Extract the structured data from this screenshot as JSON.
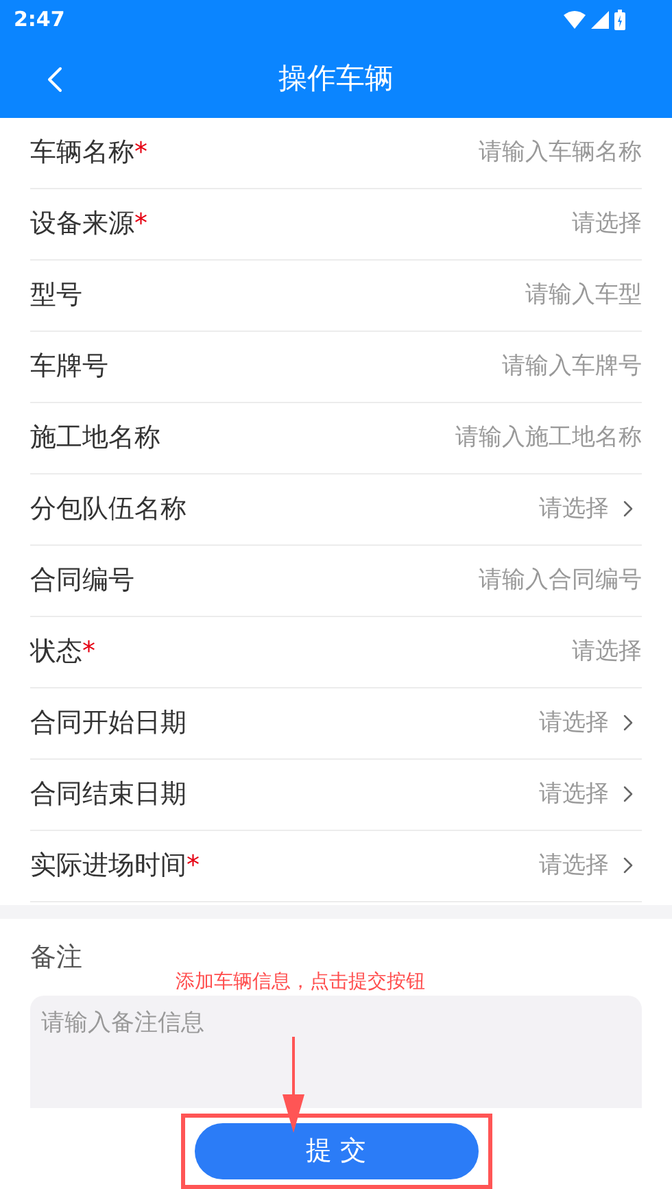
{
  "status_bar": {
    "time": "2:47"
  },
  "header": {
    "title": "操作车辆"
  },
  "fields": [
    {
      "label": "车辆名称",
      "required_mark": "*",
      "placeholder": "请输入车辆名称",
      "chevron": false
    },
    {
      "label": "设备来源",
      "required_mark": "*",
      "placeholder": "请选择",
      "chevron": false
    },
    {
      "label": "型号",
      "placeholder": "请输入车型",
      "chevron": false
    },
    {
      "label": "车牌号",
      "placeholder": "请输入车牌号",
      "chevron": false
    },
    {
      "label": "施工地名称",
      "placeholder": "请输入施工地名称",
      "chevron": false
    },
    {
      "label": "分包队伍名称",
      "placeholder": "请选择",
      "chevron": true
    },
    {
      "label": "合同编号",
      "placeholder": "请输入合同编号",
      "chevron": false
    },
    {
      "label": "状态",
      "required_mark": "*",
      "placeholder": "请选择",
      "chevron": false
    },
    {
      "label": "合同开始日期",
      "placeholder": "请选择",
      "chevron": true
    },
    {
      "label": "合同结束日期",
      "placeholder": "请选择",
      "chevron": true
    },
    {
      "label": "实际进场时间",
      "required_mark": "*",
      "placeholder": "请选择",
      "chevron": true
    }
  ],
  "remark": {
    "label": "备注",
    "placeholder": "请输入备注信息"
  },
  "annotation": {
    "text": "添加车辆信息，点击提交按钮"
  },
  "submit": {
    "label": "提 交"
  }
}
